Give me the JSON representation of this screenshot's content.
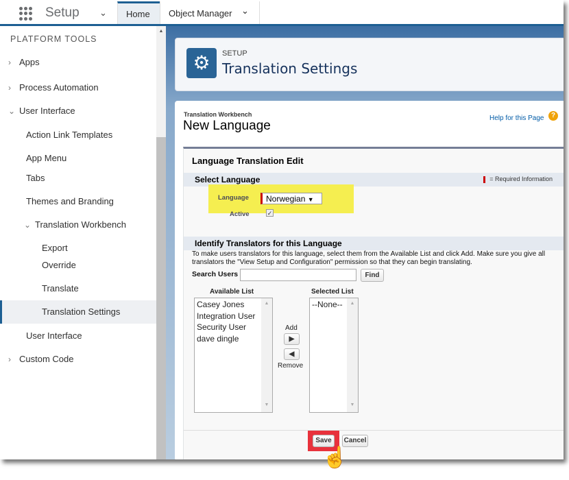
{
  "topbar": {
    "app_name": "Setup",
    "tabs": [
      {
        "label": "Home"
      },
      {
        "label": "Object Manager"
      }
    ]
  },
  "sidebar": {
    "section": "PLATFORM TOOLS",
    "items": [
      {
        "label": "Apps"
      },
      {
        "label": "Process Automation"
      },
      {
        "label": "User Interface"
      },
      {
        "label": "Action Link Templates"
      },
      {
        "label": "App Menu"
      },
      {
        "label": "Tabs"
      },
      {
        "label": "Themes and Branding"
      },
      {
        "label": "Translation Workbench"
      },
      {
        "label": "Export"
      },
      {
        "label": "Override"
      },
      {
        "label": "Translate"
      },
      {
        "label": "Translation Settings"
      },
      {
        "label": "User Interface"
      },
      {
        "label": "Custom Code"
      }
    ]
  },
  "header": {
    "eyebrow": "SETUP",
    "title": "Translation Settings"
  },
  "page": {
    "breadcrumb": "Translation Workbench",
    "title": "New Language",
    "help": "Help for this Page",
    "help_icon": "?"
  },
  "form": {
    "title": "Language Translation Edit",
    "section1": "Select Language",
    "required": "= Required Information",
    "language_label": "Language",
    "language_value": "Norwegian",
    "active_label": "Active",
    "active_checked": true,
    "section2": "Identify Translators for this Language",
    "description": "To make users translators for this language, select them from the Available List and click Add. Make sure you give all translators the \"View Setup and Configuration\" permission so that they can begin translating.",
    "search_label": "Search Users",
    "search_value": "",
    "find": "Find",
    "available_label": "Available List",
    "available": [
      "Casey Jones",
      "Integration User",
      "Security User",
      "dave dingle"
    ],
    "selected_label": "Selected List",
    "selected": [
      "--None--"
    ],
    "add": "Add",
    "remove": "Remove",
    "save": "Save",
    "cancel": "Cancel"
  },
  "colors": {
    "brand": "#1d5f93",
    "highlight": "#f5ee50",
    "save_highlight": "#e8323c"
  }
}
